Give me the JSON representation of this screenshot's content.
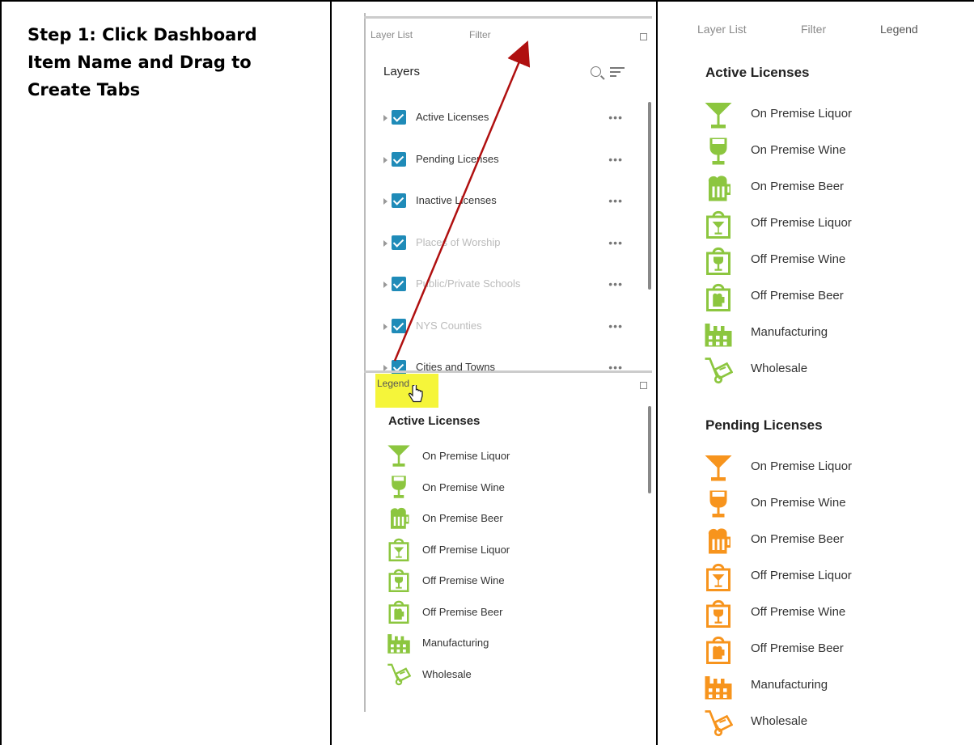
{
  "step": {
    "title": "Step 1: Click Dashboard Item Name and Drag to Create Tabs"
  },
  "colors": {
    "checkbox": "#1f8bb8",
    "active_green": "#8cc63f",
    "pending_orange": "#f7941d",
    "highlight_yellow": "#f5f53a",
    "arrow_red": "#b01010"
  },
  "before": {
    "tabs": [
      "Layer List",
      "Filter"
    ],
    "panel_title": "Layers",
    "layers": [
      {
        "label": "Active Licenses",
        "dim": false
      },
      {
        "label": "Pending Licenses",
        "dim": false
      },
      {
        "label": "Inactive Licenses",
        "dim": false
      },
      {
        "label": "Places of Worship",
        "dim": true
      },
      {
        "label": "Public/Private Schools",
        "dim": true
      },
      {
        "label": "NYS Counties",
        "dim": true
      },
      {
        "label": "Cities and Towns",
        "dim": false
      }
    ],
    "more_glyph": "•••",
    "legend_tab": "Legend",
    "legend_heading": "Active Licenses"
  },
  "after": {
    "tabs": [
      "Layer List",
      "Filter",
      "Legend"
    ],
    "groups": [
      {
        "heading": "Active Licenses",
        "color": "#8cc63f"
      },
      {
        "heading": "Pending Licenses",
        "color": "#f7941d"
      }
    ]
  },
  "legend_items": [
    {
      "label": "On Premise Liquor",
      "icon": "martini-glass-icon"
    },
    {
      "label": "On Premise Wine",
      "icon": "wine-glass-icon"
    },
    {
      "label": "On Premise Beer",
      "icon": "beer-mug-icon"
    },
    {
      "label": "Off Premise Liquor",
      "icon": "bagged-martini-icon"
    },
    {
      "label": "Off Premise Wine",
      "icon": "bagged-wine-icon"
    },
    {
      "label": "Off Premise Beer",
      "icon": "bagged-beer-icon"
    },
    {
      "label": "Manufacturing",
      "icon": "factory-icon"
    },
    {
      "label": "Wholesale",
      "icon": "hand-truck-icon"
    }
  ]
}
